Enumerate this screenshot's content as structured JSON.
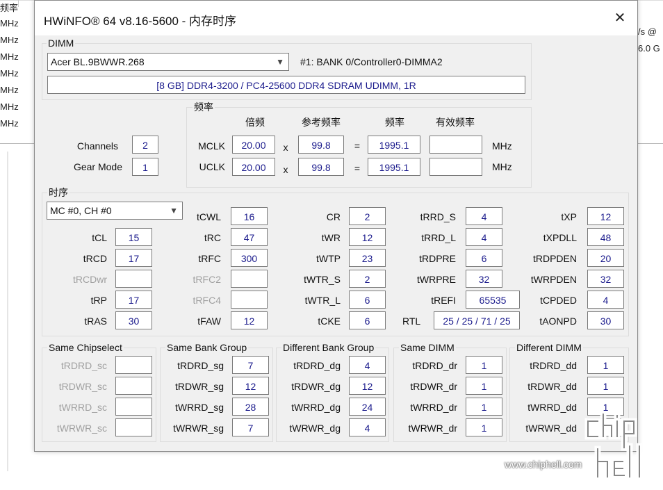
{
  "background": {
    "left_items": [
      "频率",
      "MHz",
      "MHz",
      "MHz",
      "MHz",
      "MHz",
      "MHz",
      "MHz"
    ],
    "right_items": [
      "/s @",
      "6.0 G"
    ]
  },
  "window": {
    "title": "HWiNFO® 64 v8.16-5600 - 内存时序",
    "close_glyph": "✕"
  },
  "dimm": {
    "group_label": "DIMM",
    "selected": "Acer BL.9BWWR.268",
    "slot": "#1: BANK 0/Controller0-DIMMA2",
    "summary": "[8 GB] DDR4-3200 / PC4-25600 DDR4 SDRAM UDIMM, 1R"
  },
  "freq": {
    "group_label": "频率",
    "headers": {
      "multiplier": "倍频",
      "ref": "参考频率",
      "freq": "频率",
      "effective": "有效频率"
    },
    "channels_label": "Channels",
    "channels": "2",
    "gear_label": "Gear Mode",
    "gear": "1",
    "rows": [
      {
        "label": "MCLK",
        "mult": "20.00",
        "x": "x",
        "ref": "99.8",
        "eq": "=",
        "freq": "1995.1",
        "eff": "",
        "unit": "MHz"
      },
      {
        "label": "UCLK",
        "mult": "20.00",
        "x": "x",
        "ref": "99.8",
        "eq": "=",
        "freq": "1995.1",
        "eff": "",
        "unit": "MHz"
      }
    ]
  },
  "timing": {
    "group_label": "时序",
    "channel_select": "MC #0, CH #0",
    "col1": [
      {
        "label": "tCL",
        "value": "15"
      },
      {
        "label": "tRCD",
        "value": "17"
      },
      {
        "label": "tRCDwr",
        "value": ""
      },
      {
        "label": "tRP",
        "value": "17"
      },
      {
        "label": "tRAS",
        "value": "30"
      }
    ],
    "col2": [
      {
        "label": "tCWL",
        "value": "16"
      },
      {
        "label": "tRC",
        "value": "47"
      },
      {
        "label": "tRFC",
        "value": "300"
      },
      {
        "label": "tRFC2",
        "value": ""
      },
      {
        "label": "tRFC4",
        "value": ""
      },
      {
        "label": "tFAW",
        "value": "12"
      }
    ],
    "col3": [
      {
        "label": "CR",
        "value": "2"
      },
      {
        "label": "tWR",
        "value": "12"
      },
      {
        "label": "tWTP",
        "value": "23"
      },
      {
        "label": "tWTR_S",
        "value": "2"
      },
      {
        "label": "tWTR_L",
        "value": "6"
      },
      {
        "label": "tCKE",
        "value": "6"
      }
    ],
    "col4": [
      {
        "label": "tRRD_S",
        "value": "4"
      },
      {
        "label": "tRRD_L",
        "value": "4"
      },
      {
        "label": "tRDPRE",
        "value": "6"
      },
      {
        "label": "tWRPRE",
        "value": "32"
      },
      {
        "label": "tREFI",
        "value": "65535"
      },
      {
        "label": "RTL",
        "value": "25 / 25 / 71 / 25"
      }
    ],
    "col5": [
      {
        "label": "tXP",
        "value": "12"
      },
      {
        "label": "tXPDLL",
        "value": "48"
      },
      {
        "label": "tRDPDEN",
        "value": "20"
      },
      {
        "label": "tWRPDEN",
        "value": "32"
      },
      {
        "label": "tCPDED",
        "value": "4"
      },
      {
        "label": "tAONPD",
        "value": "30"
      }
    ]
  },
  "groups": [
    {
      "label": "Same Chipselect",
      "rows": [
        {
          "label": "tRDRD_sc",
          "value": ""
        },
        {
          "label": "tRDWR_sc",
          "value": ""
        },
        {
          "label": "tWRRD_sc",
          "value": ""
        },
        {
          "label": "tWRWR_sc",
          "value": ""
        }
      ]
    },
    {
      "label": "Same Bank Group",
      "rows": [
        {
          "label": "tRDRD_sg",
          "value": "7"
        },
        {
          "label": "tRDWR_sg",
          "value": "12"
        },
        {
          "label": "tWRRD_sg",
          "value": "28"
        },
        {
          "label": "tWRWR_sg",
          "value": "7"
        }
      ]
    },
    {
      "label": "Different Bank Group",
      "rows": [
        {
          "label": "tRDRD_dg",
          "value": "4"
        },
        {
          "label": "tRDWR_dg",
          "value": "12"
        },
        {
          "label": "tWRRD_dg",
          "value": "24"
        },
        {
          "label": "tWRWR_dg",
          "value": "4"
        }
      ]
    },
    {
      "label": "Same DIMM",
      "rows": [
        {
          "label": "tRDRD_dr",
          "value": "1"
        },
        {
          "label": "tRDWR_dr",
          "value": "1"
        },
        {
          "label": "tWRRD_dr",
          "value": "1"
        },
        {
          "label": "tWRWR_dr",
          "value": "1"
        }
      ]
    },
    {
      "label": "Different DIMM",
      "rows": [
        {
          "label": "tRDRD_dd",
          "value": "1"
        },
        {
          "label": "tRDWR_dd",
          "value": "1"
        },
        {
          "label": "tWRRD_dd",
          "value": "1"
        },
        {
          "label": "tWRWR_dd",
          "value": ""
        }
      ]
    }
  ],
  "watermark": {
    "logo": "chip hell",
    "url": "www.chiphell.com"
  },
  "colors": {
    "value_text": "#1a1a8c",
    "disabled_text": "#a0a0a0",
    "window_bg": "#f0f0f0"
  }
}
